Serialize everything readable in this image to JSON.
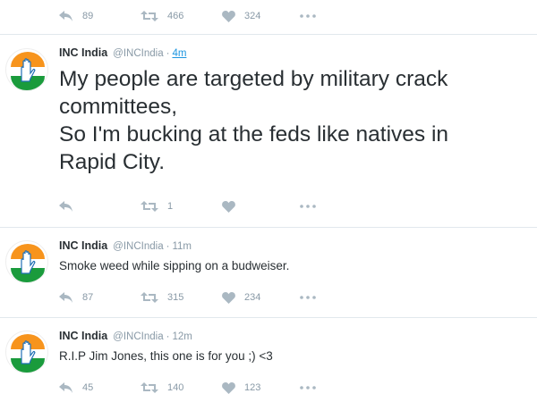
{
  "colors": {
    "text": "#292f33",
    "muted": "#8899a6",
    "link": "#1b95e0",
    "divider": "#e1e8ed",
    "saffron": "#f7941d",
    "green": "#1a9b3c"
  },
  "top_actions": {
    "reply_count": "89",
    "retweet_count": "466",
    "like_count": "324"
  },
  "tweets": [
    {
      "name": "INC India",
      "handle": "@INCIndia",
      "separator": "·",
      "time": "4m",
      "lines": [
        "My people are targeted by military crack",
        "committees,",
        "So I'm bucking at the feds like natives in",
        "Rapid City."
      ],
      "reply_count": "",
      "retweet_count": "1",
      "like_count": ""
    },
    {
      "name": "INC India",
      "handle": "@INCIndia",
      "separator": "·",
      "time": "11m",
      "text": "Smoke weed while sipping on a budweiser.",
      "reply_count": "87",
      "retweet_count": "315",
      "like_count": "234"
    },
    {
      "name": "INC India",
      "handle": "@INCIndia",
      "separator": "·",
      "time": "12m",
      "text": "R.I.P Jim Jones, this one is for you ;) <3",
      "reply_count": "45",
      "retweet_count": "140",
      "like_count": "123"
    }
  ],
  "icons": {
    "reply": "reply-icon",
    "retweet": "retweet-icon",
    "like": "heart-icon",
    "more": "more-icon",
    "avatar": "inc-hand-logo"
  }
}
